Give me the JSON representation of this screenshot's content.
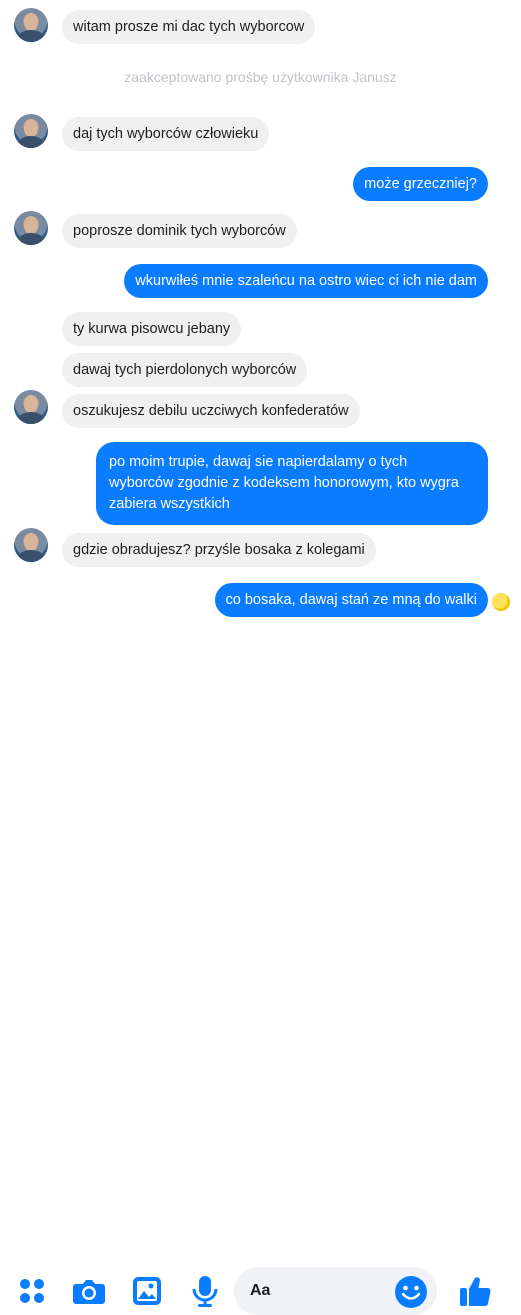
{
  "colors": {
    "accent": "#0a7cff",
    "incoming_bubble": "#f0f0f0",
    "system_text": "#c0c4c8"
  },
  "messages": [
    {
      "text": "witam prosze mi dac tych wyborcow"
    },
    {
      "text": "zaakceptowano prośbę użytkownika Janusz"
    },
    {
      "text": "daj tych wyborców człowieku"
    },
    {
      "text": "może grzeczniej?"
    },
    {
      "text": "poprosze dominik tych wyborców"
    },
    {
      "text": "wkurwiłeś mnie szaleńcu na ostro wiec ci ich nie dam"
    },
    {
      "text": "ty kurwa pisowcu jebany"
    },
    {
      "text": "dawaj tych pierdolonych wyborców"
    },
    {
      "text": "oszukujesz debilu uczciwych konfederatów"
    },
    {
      "text": "po moim trupie, dawaj sie napierdalamy o tych wyborców zgodnie z kodeksem honorowym, kto wygra zabiera wszystkich"
    },
    {
      "text": "gdzie obradujesz? przyśle bosaka z kolegami"
    },
    {
      "text": "co bosaka, dawaj stań ze mną do walki"
    }
  ],
  "composer": {
    "placeholder": "Aa",
    "icons": [
      "apps-icon",
      "camera-icon",
      "gallery-icon",
      "microphone-icon",
      "emoji-icon",
      "thumbs-up-icon"
    ]
  }
}
